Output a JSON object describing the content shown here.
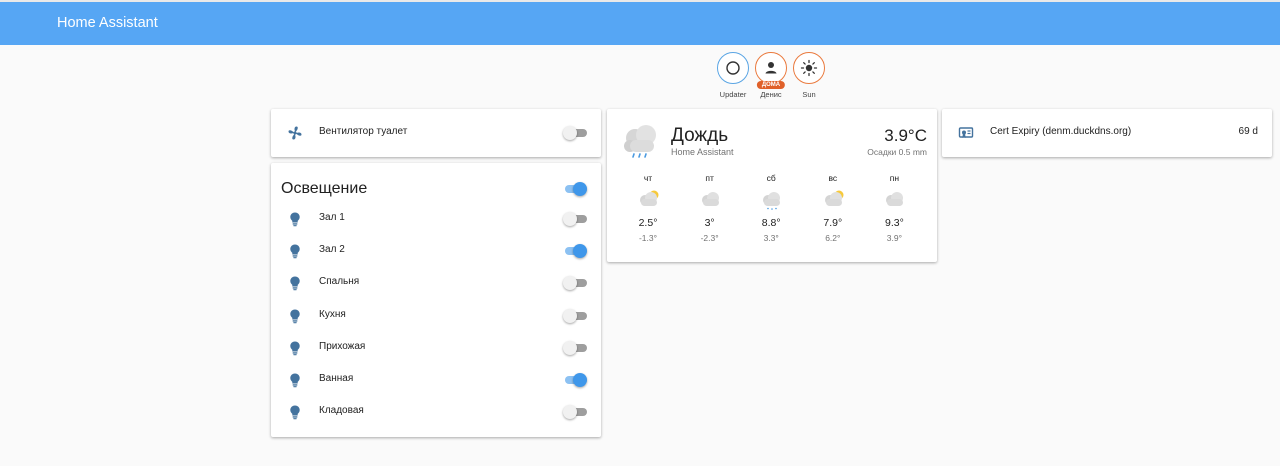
{
  "app": {
    "title": "Home Assistant"
  },
  "badges": [
    {
      "label": "Updater",
      "icon": "circle-outline-icon",
      "tag": ""
    },
    {
      "label": "Денис",
      "icon": "account-icon",
      "tag": "ДОМА"
    },
    {
      "label": "Sun",
      "icon": "sun-icon",
      "tag": ""
    }
  ],
  "fan_card": {
    "name": "Вентилятор туалет",
    "state": "off",
    "icon": "fan-icon"
  },
  "lights_card": {
    "title": "Освещение",
    "master_state": "on",
    "items": [
      {
        "name": "Зал 1",
        "state": "off"
      },
      {
        "name": "Зал 2",
        "state": "on"
      },
      {
        "name": "Спальня",
        "state": "off"
      },
      {
        "name": "Кухня",
        "state": "off"
      },
      {
        "name": "Прихожая",
        "state": "off"
      },
      {
        "name": "Ванная",
        "state": "on"
      },
      {
        "name": "Кладовая",
        "state": "off"
      }
    ]
  },
  "weather_card": {
    "condition": "Дождь",
    "source": "Home Assistant",
    "temperature": "3.9°C",
    "precipitation": "Осадки 0.5 mm",
    "forecast": [
      {
        "day": "чт",
        "hi": "2.5°",
        "lo": "-1.3°",
        "icon": "partly-cloudy-icon"
      },
      {
        "day": "пт",
        "hi": "3°",
        "lo": "-2.3°",
        "icon": "cloudy-icon"
      },
      {
        "day": "сб",
        "hi": "8.8°",
        "lo": "3.3°",
        "icon": "rainy-icon"
      },
      {
        "day": "вс",
        "hi": "7.9°",
        "lo": "6.2°",
        "icon": "partly-cloudy-icon"
      },
      {
        "day": "пн",
        "hi": "9.3°",
        "lo": "3.9°",
        "icon": "cloudy-icon"
      }
    ]
  },
  "cert_card": {
    "name": "Cert Expiry (denm.duckdns.org)",
    "value": "69 d",
    "icon": "certificate-icon"
  },
  "colors": {
    "header": "#56a6f4",
    "switch_on": "#3f97ea",
    "icon": "#44739e",
    "person_ring": "#ea7a3e",
    "tag": "#e0612a"
  }
}
